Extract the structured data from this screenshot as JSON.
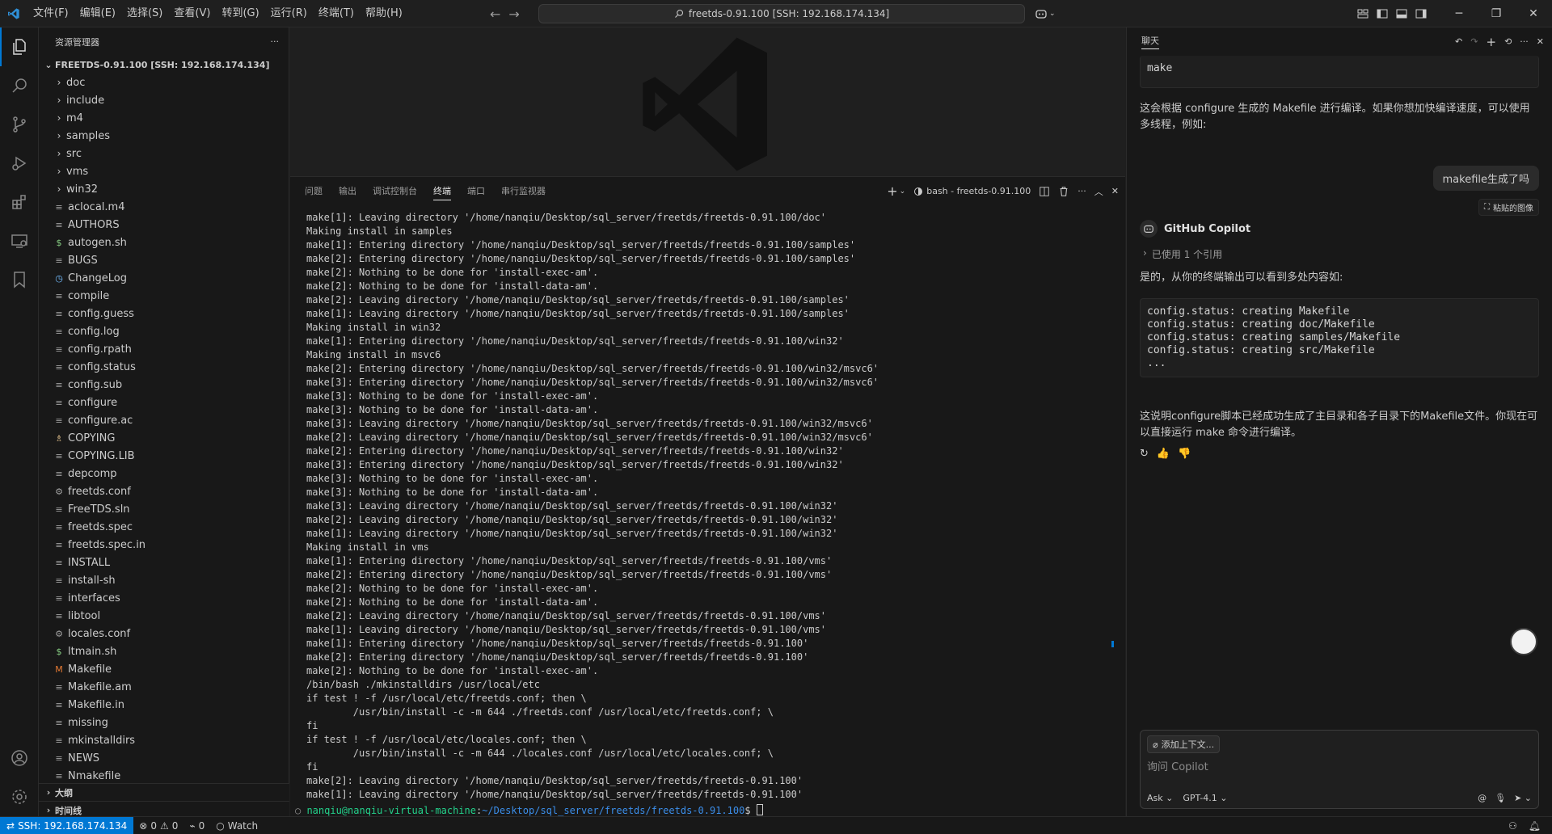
{
  "titlebar": {
    "menu": [
      "文件(F)",
      "编辑(E)",
      "选择(S)",
      "查看(V)",
      "转到(G)",
      "运行(R)",
      "终端(T)",
      "帮助(H)"
    ],
    "search_text": "freetds-0.91.100 [SSH: 192.168.174.134]"
  },
  "sidebar": {
    "title": "资源管理器",
    "root": "FREETDS-0.91.100 [SSH: 192.168.174.134]",
    "items": [
      {
        "label": "doc",
        "type": "folder",
        "icon": "chevron"
      },
      {
        "label": "include",
        "type": "folder",
        "icon": "chevron"
      },
      {
        "label": "m4",
        "type": "folder",
        "icon": "chevron"
      },
      {
        "label": "samples",
        "type": "folder",
        "icon": "chevron"
      },
      {
        "label": "src",
        "type": "folder",
        "icon": "chevron"
      },
      {
        "label": "vms",
        "type": "folder",
        "icon": "chevron"
      },
      {
        "label": "win32",
        "type": "folder",
        "icon": "chevron"
      },
      {
        "label": "aclocal.m4",
        "type": "file",
        "icon": "lines"
      },
      {
        "label": "AUTHORS",
        "type": "file",
        "icon": "lines"
      },
      {
        "label": "autogen.sh",
        "type": "file",
        "icon": "dollar"
      },
      {
        "label": "BUGS",
        "type": "file",
        "icon": "lines"
      },
      {
        "label": "ChangeLog",
        "type": "file",
        "icon": "clock"
      },
      {
        "label": "compile",
        "type": "file",
        "icon": "lines"
      },
      {
        "label": "config.guess",
        "type": "file",
        "icon": "lines"
      },
      {
        "label": "config.log",
        "type": "file",
        "icon": "lines"
      },
      {
        "label": "config.rpath",
        "type": "file",
        "icon": "lines"
      },
      {
        "label": "config.status",
        "type": "file",
        "icon": "lines"
      },
      {
        "label": "config.sub",
        "type": "file",
        "icon": "lines"
      },
      {
        "label": "configure",
        "type": "file",
        "icon": "lines"
      },
      {
        "label": "configure.ac",
        "type": "file",
        "icon": "lines"
      },
      {
        "label": "COPYING",
        "type": "file",
        "icon": "license"
      },
      {
        "label": "COPYING.LIB",
        "type": "file",
        "icon": "lines"
      },
      {
        "label": "depcomp",
        "type": "file",
        "icon": "lines"
      },
      {
        "label": "freetds.conf",
        "type": "file",
        "icon": "gear"
      },
      {
        "label": "FreeTDS.sln",
        "type": "file",
        "icon": "lines"
      },
      {
        "label": "freetds.spec",
        "type": "file",
        "icon": "lines"
      },
      {
        "label": "freetds.spec.in",
        "type": "file",
        "icon": "lines"
      },
      {
        "label": "INSTALL",
        "type": "file",
        "icon": "lines"
      },
      {
        "label": "install-sh",
        "type": "file",
        "icon": "lines"
      },
      {
        "label": "interfaces",
        "type": "file",
        "icon": "lines"
      },
      {
        "label": "libtool",
        "type": "file",
        "icon": "lines"
      },
      {
        "label": "locales.conf",
        "type": "file",
        "icon": "gear"
      },
      {
        "label": "ltmain.sh",
        "type": "file",
        "icon": "dollar"
      },
      {
        "label": "Makefile",
        "type": "file",
        "icon": "makefile"
      },
      {
        "label": "Makefile.am",
        "type": "file",
        "icon": "lines"
      },
      {
        "label": "Makefile.in",
        "type": "file",
        "icon": "lines"
      },
      {
        "label": "missing",
        "type": "file",
        "icon": "lines"
      },
      {
        "label": "mkinstalldirs",
        "type": "file",
        "icon": "lines"
      },
      {
        "label": "NEWS",
        "type": "file",
        "icon": "lines"
      },
      {
        "label": "Nmakefile",
        "type": "file",
        "icon": "lines"
      }
    ],
    "outline": "大纲",
    "timeline": "时间线"
  },
  "panel": {
    "tabs": [
      "问题",
      "输出",
      "调试控制台",
      "终端",
      "端口",
      "串行监视器"
    ],
    "active_tab": 3,
    "terminal_name": "bash - freetds-0.91.100",
    "lines": [
      "make[1]: Leaving directory '/home/nanqiu/Desktop/sql_server/freetds/freetds-0.91.100/doc'",
      "Making install in samples",
      "make[1]: Entering directory '/home/nanqiu/Desktop/sql_server/freetds/freetds-0.91.100/samples'",
      "make[2]: Entering directory '/home/nanqiu/Desktop/sql_server/freetds/freetds-0.91.100/samples'",
      "make[2]: Nothing to be done for 'install-exec-am'.",
      "make[2]: Nothing to be done for 'install-data-am'.",
      "make[2]: Leaving directory '/home/nanqiu/Desktop/sql_server/freetds/freetds-0.91.100/samples'",
      "make[1]: Leaving directory '/home/nanqiu/Desktop/sql_server/freetds/freetds-0.91.100/samples'",
      "Making install in win32",
      "make[1]: Entering directory '/home/nanqiu/Desktop/sql_server/freetds/freetds-0.91.100/win32'",
      "Making install in msvc6",
      "make[2]: Entering directory '/home/nanqiu/Desktop/sql_server/freetds/freetds-0.91.100/win32/msvc6'",
      "make[3]: Entering directory '/home/nanqiu/Desktop/sql_server/freetds/freetds-0.91.100/win32/msvc6'",
      "make[3]: Nothing to be done for 'install-exec-am'.",
      "make[3]: Nothing to be done for 'install-data-am'.",
      "make[3]: Leaving directory '/home/nanqiu/Desktop/sql_server/freetds/freetds-0.91.100/win32/msvc6'",
      "make[2]: Leaving directory '/home/nanqiu/Desktop/sql_server/freetds/freetds-0.91.100/win32/msvc6'",
      "make[2]: Entering directory '/home/nanqiu/Desktop/sql_server/freetds/freetds-0.91.100/win32'",
      "make[3]: Entering directory '/home/nanqiu/Desktop/sql_server/freetds/freetds-0.91.100/win32'",
      "make[3]: Nothing to be done for 'install-exec-am'.",
      "make[3]: Nothing to be done for 'install-data-am'.",
      "make[3]: Leaving directory '/home/nanqiu/Desktop/sql_server/freetds/freetds-0.91.100/win32'",
      "make[2]: Leaving directory '/home/nanqiu/Desktop/sql_server/freetds/freetds-0.91.100/win32'",
      "make[1]: Leaving directory '/home/nanqiu/Desktop/sql_server/freetds/freetds-0.91.100/win32'",
      "Making install in vms",
      "make[1]: Entering directory '/home/nanqiu/Desktop/sql_server/freetds/freetds-0.91.100/vms'",
      "make[2]: Entering directory '/home/nanqiu/Desktop/sql_server/freetds/freetds-0.91.100/vms'",
      "make[2]: Nothing to be done for 'install-exec-am'.",
      "make[2]: Nothing to be done for 'install-data-am'.",
      "make[2]: Leaving directory '/home/nanqiu/Desktop/sql_server/freetds/freetds-0.91.100/vms'",
      "make[1]: Leaving directory '/home/nanqiu/Desktop/sql_server/freetds/freetds-0.91.100/vms'",
      "make[1]: Entering directory '/home/nanqiu/Desktop/sql_server/freetds/freetds-0.91.100'",
      "make[2]: Entering directory '/home/nanqiu/Desktop/sql_server/freetds/freetds-0.91.100'",
      "make[2]: Nothing to be done for 'install-exec-am'.",
      "/bin/bash ./mkinstalldirs /usr/local/etc",
      "if test ! -f /usr/local/etc/freetds.conf; then \\",
      "        /usr/bin/install -c -m 644 ./freetds.conf /usr/local/etc/freetds.conf; \\",
      "fi",
      "if test ! -f /usr/local/etc/locales.conf; then \\",
      "        /usr/bin/install -c -m 644 ./locales.conf /usr/local/etc/locales.conf; \\",
      "fi",
      "make[2]: Leaving directory '/home/nanqiu/Desktop/sql_server/freetds/freetds-0.91.100'",
      "make[1]: Leaving directory '/home/nanqiu/Desktop/sql_server/freetds/freetds-0.91.100'"
    ],
    "prompt_user": "nanqiu@nanqiu-virtual-machine",
    "prompt_path": "~/Desktop/sql_server/freetds/freetds-0.91.100",
    "prompt_symbol": "$ "
  },
  "chat": {
    "title": "聊天",
    "top_code": "make",
    "msg1": "这会根据 configure 生成的 Makefile 进行编译。如果你想加快编译速度，可以使用多线程，例如:",
    "user_msg": "makefile生成了吗",
    "pasted_image": "粘贴的图像",
    "assistant_name": "GitHub Copilot",
    "used_refs": "已使用 1 个引用",
    "answer_intro": "是的，从你的终端输出可以看到多处内容如:",
    "code_lines": [
      "config.status: creating Makefile",
      "config.status: creating doc/Makefile",
      "config.status: creating samples/Makefile",
      "config.status: creating src/Makefile",
      "..."
    ],
    "answer_conclusion": "这说明configure脚本已经成功生成了主目录和各子目录下的Makefile文件。你现在可以直接运行 make 命令进行编译。",
    "add_context": "添加上下文...",
    "input_placeholder": "询问 Copilot",
    "mode": "Ask",
    "model": "GPT-4.1"
  },
  "statusbar": {
    "remote": "SSH: 192.168.174.134",
    "errors": "0",
    "warnings": "0",
    "ports": "0",
    "watch": "Watch"
  },
  "colors": {
    "accent": "#0078d4",
    "prompt_user": "#23d18b",
    "prompt_path": "#3b8eea"
  }
}
